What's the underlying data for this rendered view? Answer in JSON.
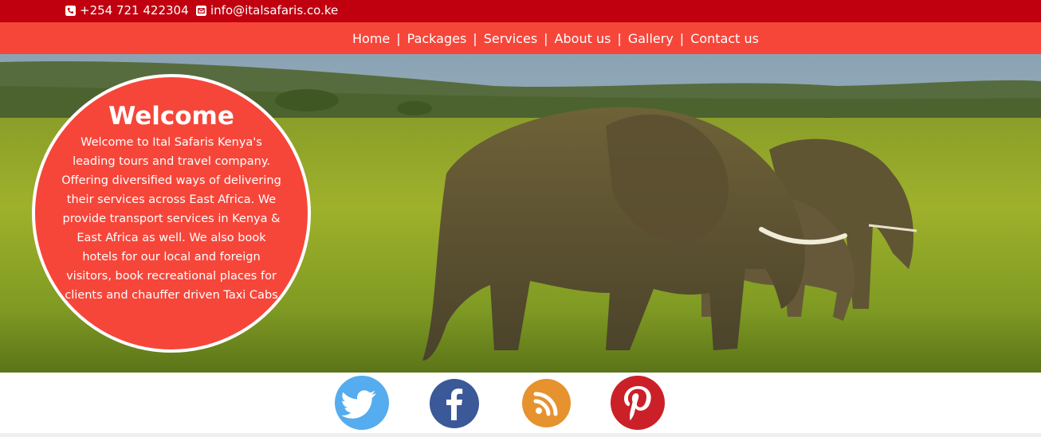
{
  "topbar": {
    "phone": "+254 721 422304",
    "email": "info@italsafaris.co.ke",
    "phone_icon": "phone-icon",
    "email_icon": "envelope-icon"
  },
  "nav": {
    "items": [
      "Home",
      "Packages",
      "Services",
      "About us",
      "Gallery",
      "Contact us"
    ],
    "separator": "|"
  },
  "welcome": {
    "title": "Welcome",
    "text": "Welcome to Ital Safaris Kenya's leading tours and travel company. Offering diversified ways of delivering their services across East Africa. We provide transport services in Kenya & East Africa as well. We also book hotels for our local and foreign visitors, book recreational places for clients and chauffer driven Taxi Cabs"
  },
  "social": [
    {
      "icon": "twitter-icon",
      "color": "#55acee"
    },
    {
      "icon": "facebook-icon",
      "color": "#3b5998"
    },
    {
      "icon": "rss-icon",
      "color": "#e6922e"
    },
    {
      "icon": "pinterest-icon",
      "color": "#cb2027"
    }
  ],
  "colors": {
    "topbar": "#c0000f",
    "navbar": "#f6463a",
    "welcome_circle": "#f6463a"
  }
}
